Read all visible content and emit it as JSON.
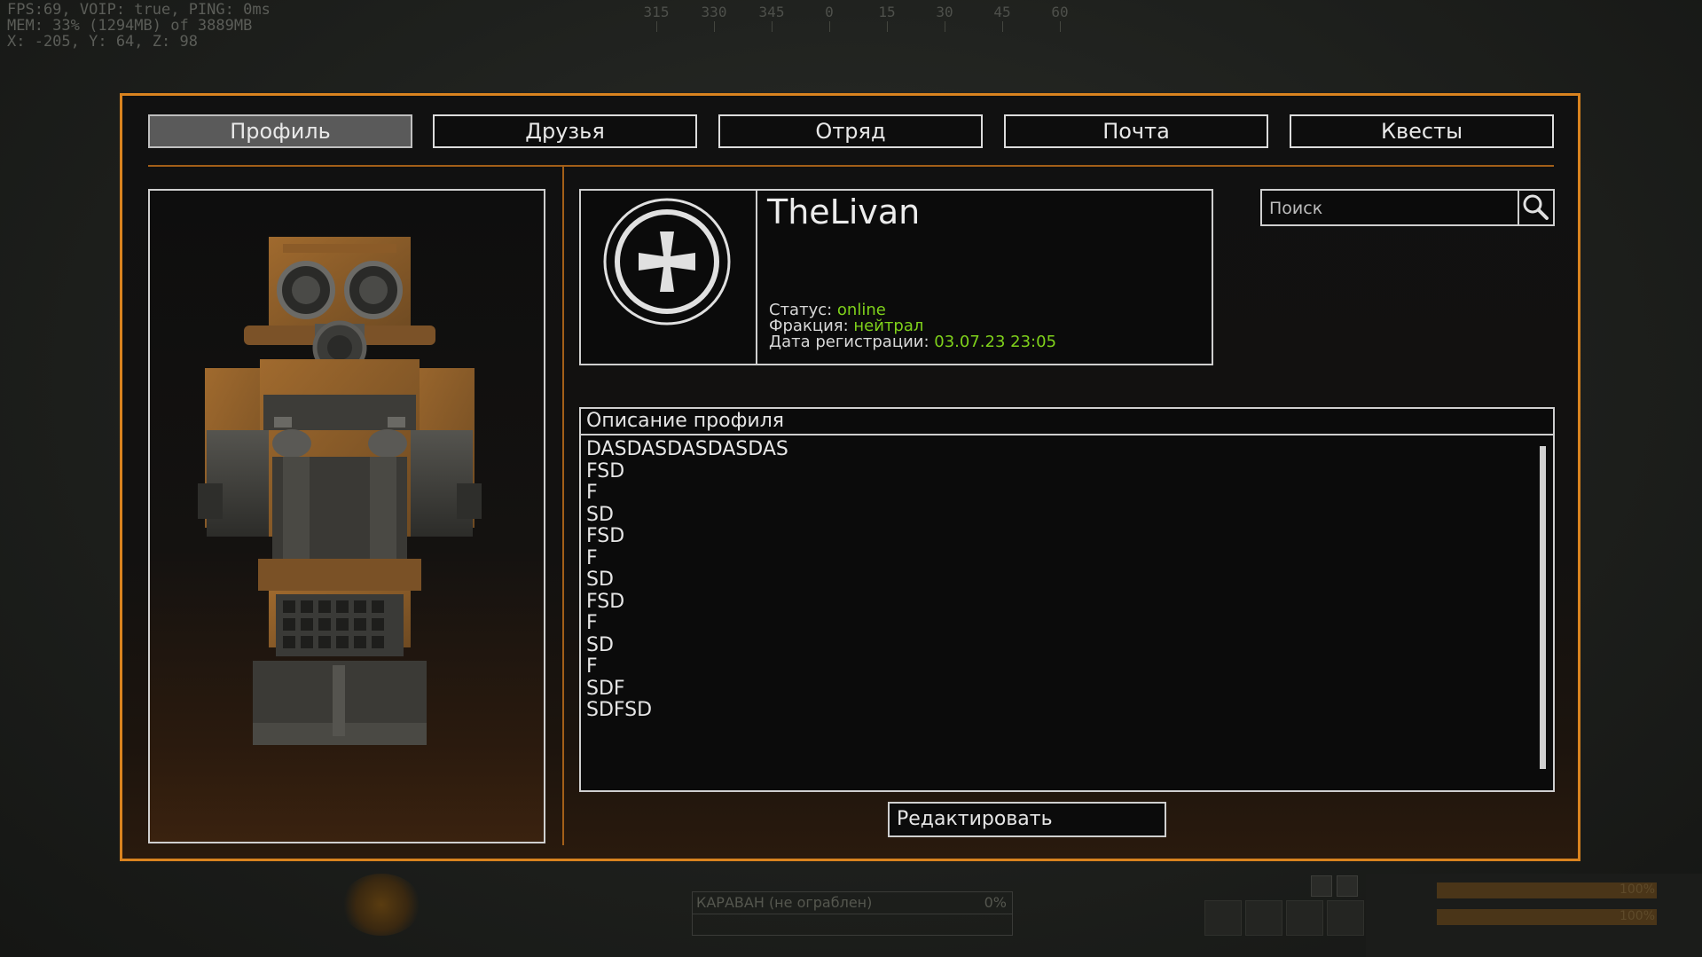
{
  "hud": {
    "fps_line": "FPS:69, VOIP: true, PING: 0ms",
    "mem_line": "MEM: 33% (1294MB) of 3889MB",
    "pos_line": "X: -205, Y: 64, Z: 98",
    "compass": [
      "315",
      "330",
      "345",
      "0",
      "15",
      "30",
      "45",
      "60"
    ]
  },
  "tabs": [
    {
      "label": "Профиль",
      "active": true
    },
    {
      "label": "Друзья",
      "active": false
    },
    {
      "label": "Отряд",
      "active": false
    },
    {
      "label": "Почта",
      "active": false
    },
    {
      "label": "Квесты",
      "active": false
    }
  ],
  "profile": {
    "username": "TheLivan",
    "status_label": "Статус: ",
    "status_value": "online",
    "faction_label": "Фракция: ",
    "faction_value": "нейтрал",
    "reg_label": "Дата регистрации: ",
    "reg_value": "03.07.23 23:05",
    "emblem_icon": "iron-cross-icon"
  },
  "search": {
    "placeholder": "Поиск",
    "value": "",
    "icon": "search-icon"
  },
  "description": {
    "title": "Описание профиля",
    "lines": [
      "DASDASDASDASDAS",
      "FSD",
      "F",
      "SD",
      "FSD",
      "F",
      "SD",
      "FSD",
      "F",
      "SD",
      "F",
      "SDF",
      "SDFSD"
    ]
  },
  "edit_button": "Редактировать",
  "bottom_hud": {
    "mission": "КАРАВАН (не ограблен)",
    "mission_pct": "0%",
    "health": "100%",
    "energy": "100%"
  },
  "colors": {
    "accent": "#d9831f",
    "status_green": "#7fd11b",
    "frame": "#cfcfcf"
  }
}
